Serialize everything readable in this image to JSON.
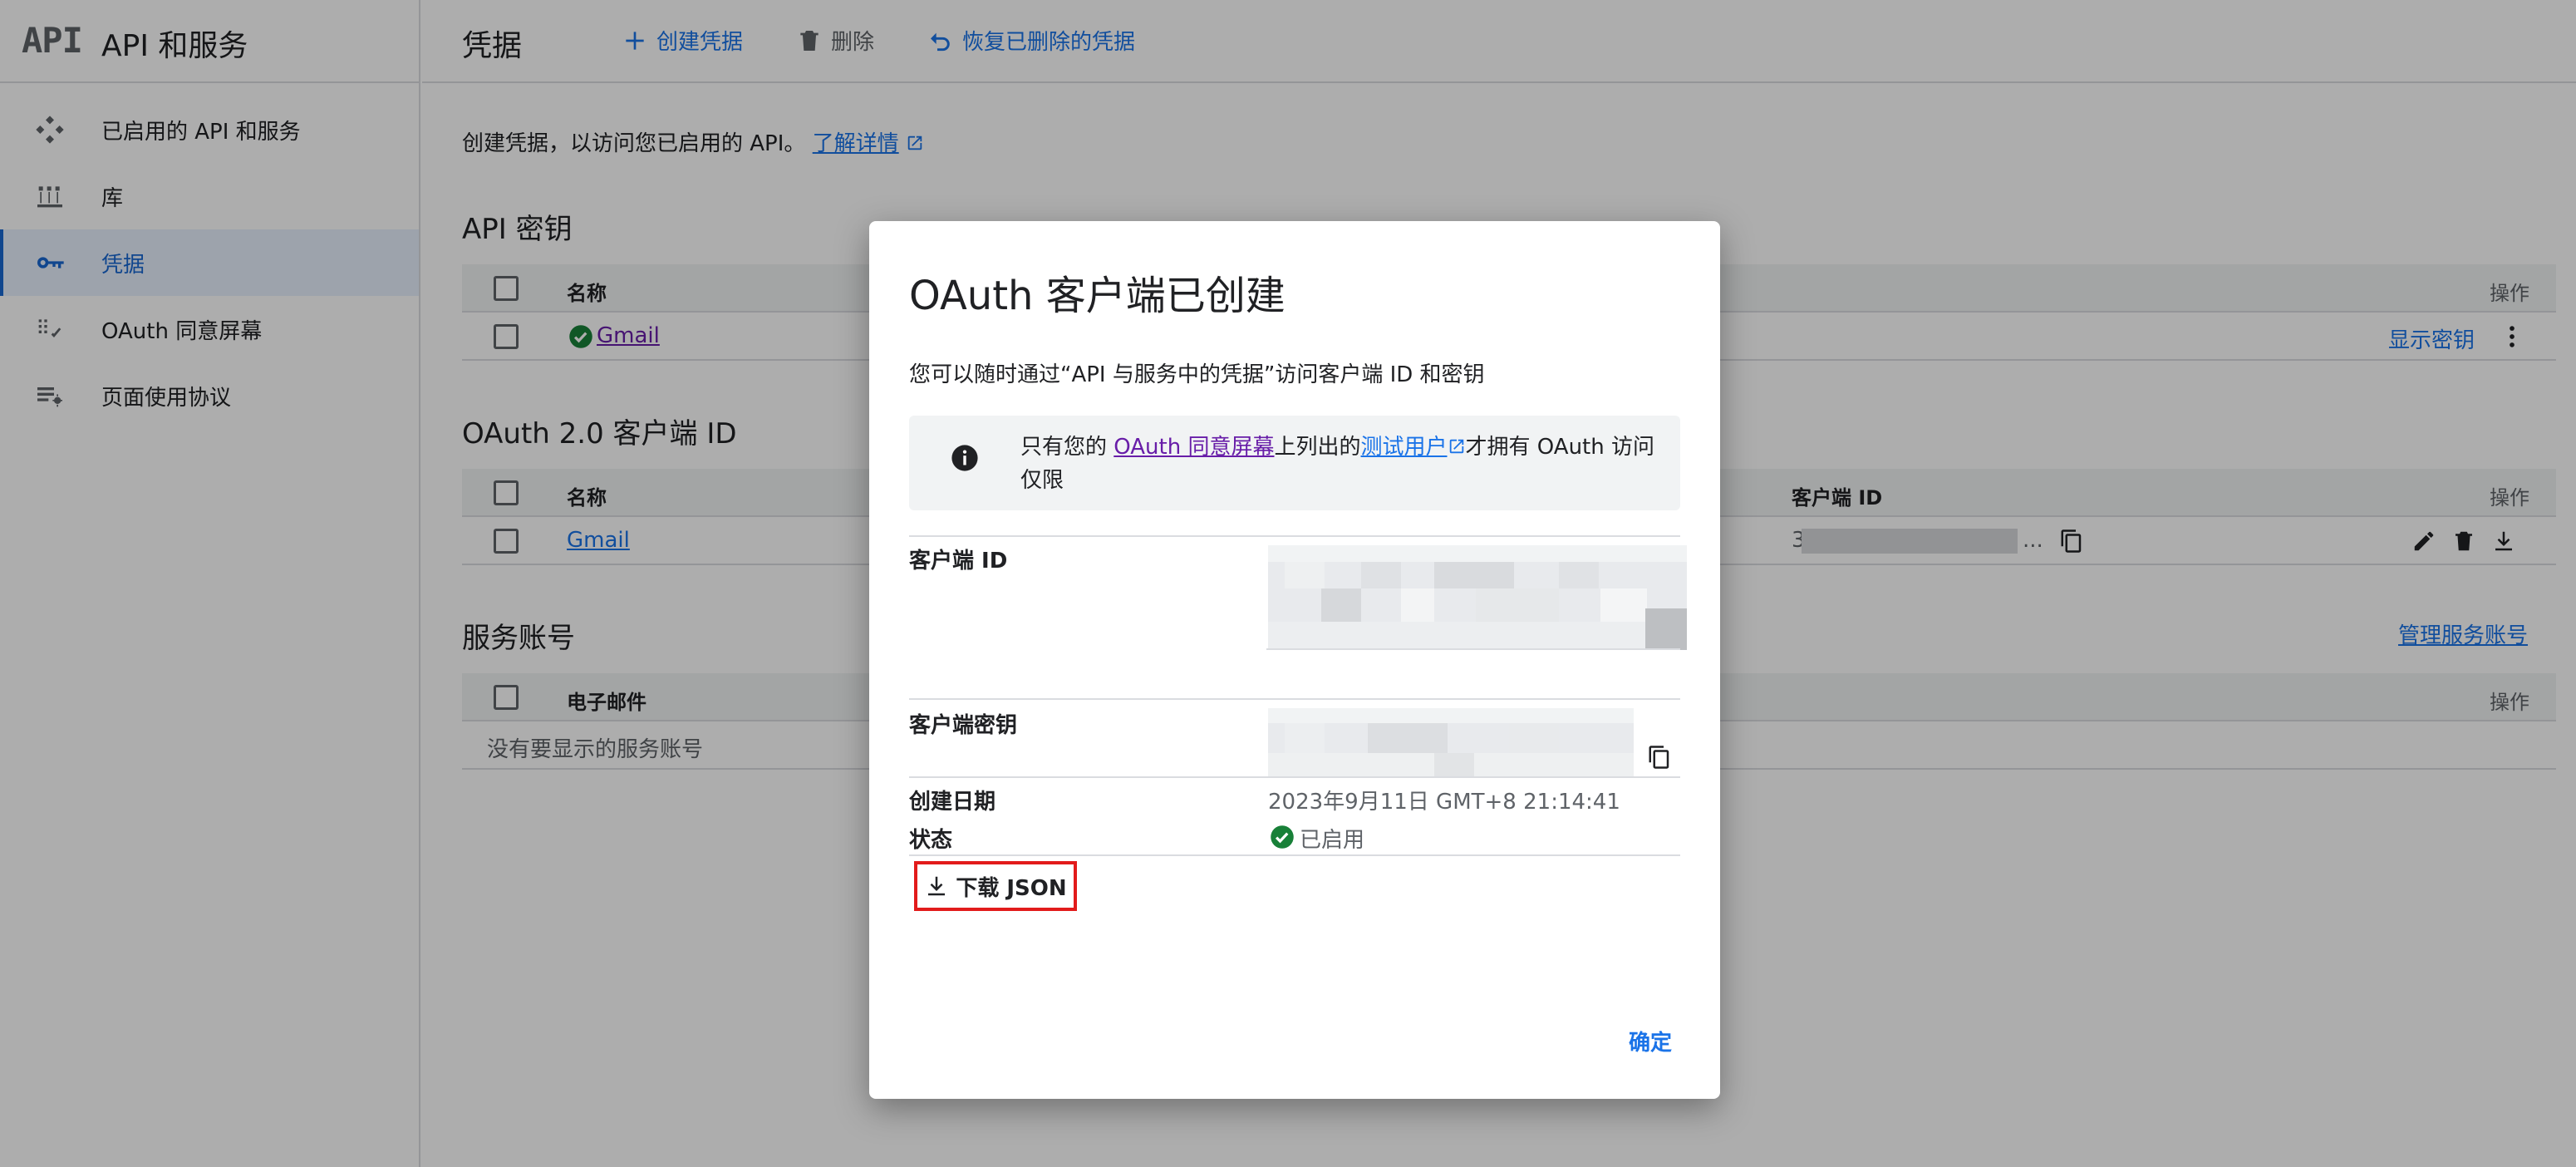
{
  "app": {
    "logo_text": "API",
    "title": "API 和服务"
  },
  "sidebar": {
    "items": [
      {
        "label": "已启用的 API 和服务",
        "icon": "enabled-apis-icon"
      },
      {
        "label": "库",
        "icon": "library-icon"
      },
      {
        "label": "凭据",
        "icon": "key-icon",
        "active": true
      },
      {
        "label": "OAuth 同意屏幕",
        "icon": "consent-screen-icon"
      },
      {
        "label": "页面使用协议",
        "icon": "page-agreement-icon"
      }
    ]
  },
  "toolbar": {
    "title": "凭据",
    "create_label": "创建凭据",
    "delete_label": "删除",
    "restore_label": "恢复已删除的凭据"
  },
  "main": {
    "intro_text": "创建凭据，以访问您已启用的 API。",
    "learn_more": "了解详情",
    "api_keys": {
      "title": "API 密钥",
      "col_name": "名称",
      "col_actions": "操作",
      "rows": [
        {
          "name": "Gmail",
          "action": "显示密钥"
        }
      ]
    },
    "oauth": {
      "title": "OAuth 2.0 客户端 ID",
      "col_name": "名称",
      "col_client_id": "客户端 ID",
      "col_actions": "操作",
      "rows": [
        {
          "name": "Gmail",
          "client_id_prefix": "3",
          "client_id_suffix": "..."
        }
      ]
    },
    "service_accounts": {
      "title": "服务账号",
      "manage_link": "管理服务账号",
      "col_email": "电子邮件",
      "col_actions": "操作",
      "empty_text": "没有要显示的服务账号"
    }
  },
  "dialog": {
    "title": "OAuth 客户端已创建",
    "subtitle": "您可以随时通过“API 与服务中的凭据”访问客户端 ID 和密钥",
    "info": {
      "pre": "只有您的 ",
      "link1": "OAuth 同意屏幕",
      "mid": "上列出的",
      "link2": "测试用户",
      "post1": "才拥有 OAuth 访问",
      "post2": "仅限"
    },
    "client_id_label": "客户端 ID",
    "client_secret_label": "客户端密钥",
    "created_label": "创建日期",
    "created_value": "2023年9月11日 GMT+8 21:14:41",
    "status_label": "状态",
    "status_value": "已启用",
    "download_label": "下载 JSON",
    "ok_label": "确定"
  },
  "colors": {
    "accent": "#1a73e8",
    "success": "#188038",
    "highlight": "#e21b1b"
  }
}
